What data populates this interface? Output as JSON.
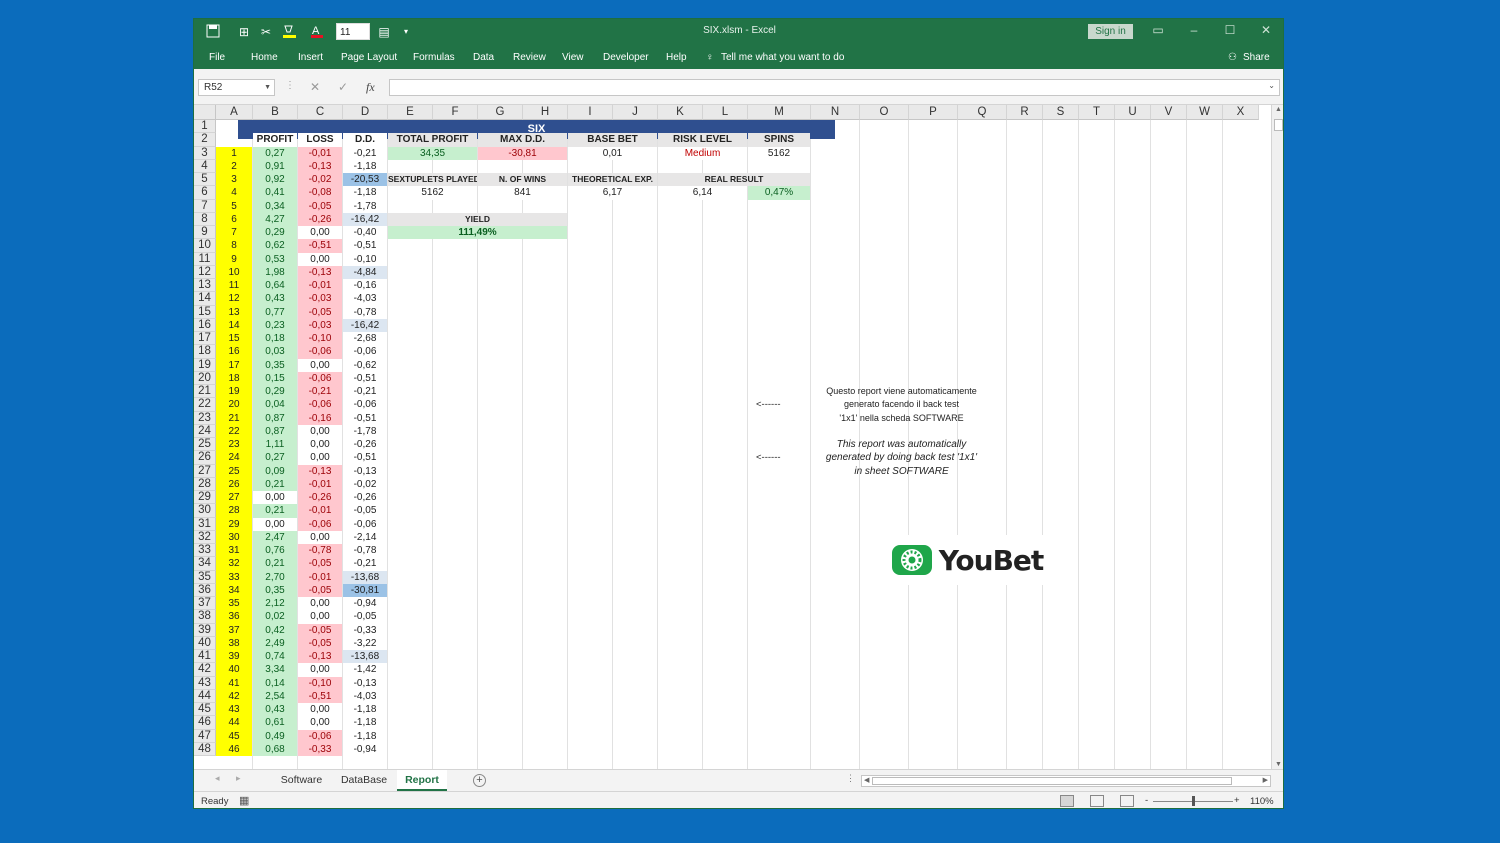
{
  "titlebar": {
    "filename": "SIX.xlsm",
    "app": "Excel",
    "sep": "-",
    "sign_in": "Sign in",
    "font_size": "11"
  },
  "menu": {
    "items": [
      "File",
      "Home",
      "Insert",
      "Page Layout",
      "Formulas",
      "Data",
      "Review",
      "View",
      "Developer",
      "Help"
    ],
    "tell_me": "Tell me what you want to do",
    "share": "Share"
  },
  "formula_bar": {
    "name_box": "R52",
    "fx": "fx",
    "value": ""
  },
  "columns": [
    "A",
    "B",
    "C",
    "D",
    "E",
    "F",
    "G",
    "H",
    "I",
    "J",
    "K",
    "L",
    "M",
    "N",
    "O",
    "P",
    "Q",
    "R",
    "S",
    "T",
    "U",
    "V",
    "W",
    "X"
  ],
  "rows": [
    1,
    2,
    3,
    4,
    5,
    6,
    7,
    8,
    9,
    10,
    11,
    12,
    13,
    14,
    15,
    16,
    17,
    18,
    19,
    20,
    21,
    22,
    23,
    24,
    25,
    26,
    27,
    28,
    29,
    30,
    31,
    32,
    33,
    34,
    35,
    36,
    37,
    38,
    39,
    40,
    41,
    42,
    43,
    44,
    45,
    46,
    47,
    48
  ],
  "sheet": {
    "title": "SIX",
    "headers": {
      "profit": "PROFIT",
      "loss": "LOSS",
      "dd": "D.D.",
      "total_profit": "TOTAL PROFIT",
      "max_dd": "MAX D.D.",
      "base_bet": "BASE BET",
      "risk_level": "RISK LEVEL",
      "spins": "SPINS"
    },
    "summary1": {
      "total_profit": "34,35",
      "max_dd": "-30,81",
      "base_bet": "0,01",
      "risk_level": "Medium",
      "spins": "5162"
    },
    "headers2": {
      "sextuplets": "SEXTUPLETS PLAYED",
      "wins": "N. OF WINS",
      "theoretical": "THEORETICAL EXP.",
      "real": "REAL RESULT"
    },
    "summary2": {
      "sextuplets": "5162",
      "wins": "841",
      "theoretical": "6,17",
      "real_value": "6,14",
      "real_pct": "0,47%"
    },
    "yield": {
      "label": "YIELD",
      "value": "111,49%"
    },
    "data_rows": [
      {
        "n": "1",
        "p": "0,27",
        "l": "-0,01",
        "d": "-0,21"
      },
      {
        "n": "2",
        "p": "0,91",
        "l": "-0,13",
        "d": "-1,18"
      },
      {
        "n": "3",
        "p": "0,92",
        "l": "-0,02",
        "d": "-20,53"
      },
      {
        "n": "4",
        "p": "0,41",
        "l": "-0,08",
        "d": "-1,18"
      },
      {
        "n": "5",
        "p": "0,34",
        "l": "-0,05",
        "d": "-1,78"
      },
      {
        "n": "6",
        "p": "4,27",
        "l": "-0,26",
        "d": "-16,42"
      },
      {
        "n": "7",
        "p": "0,29",
        "l": "0,00",
        "d": "-0,40"
      },
      {
        "n": "8",
        "p": "0,62",
        "l": "-0,51",
        "d": "-0,51"
      },
      {
        "n": "9",
        "p": "0,53",
        "l": "0,00",
        "d": "-0,10"
      },
      {
        "n": "10",
        "p": "1,98",
        "l": "-0,13",
        "d": "-4,84"
      },
      {
        "n": "11",
        "p": "0,64",
        "l": "-0,01",
        "d": "-0,16"
      },
      {
        "n": "12",
        "p": "0,43",
        "l": "-0,03",
        "d": "-4,03"
      },
      {
        "n": "13",
        "p": "0,77",
        "l": "-0,05",
        "d": "-0,78"
      },
      {
        "n": "14",
        "p": "0,23",
        "l": "-0,03",
        "d": "-16,42"
      },
      {
        "n": "15",
        "p": "0,18",
        "l": "-0,10",
        "d": "-2,68"
      },
      {
        "n": "16",
        "p": "0,03",
        "l": "-0,06",
        "d": "-0,06"
      },
      {
        "n": "17",
        "p": "0,35",
        "l": "0,00",
        "d": "-0,62"
      },
      {
        "n": "18",
        "p": "0,15",
        "l": "-0,06",
        "d": "-0,51"
      },
      {
        "n": "19",
        "p": "0,29",
        "l": "-0,21",
        "d": "-0,21"
      },
      {
        "n": "20",
        "p": "0,04",
        "l": "-0,06",
        "d": "-0,06"
      },
      {
        "n": "21",
        "p": "0,87",
        "l": "-0,16",
        "d": "-0,51"
      },
      {
        "n": "22",
        "p": "0,87",
        "l": "0,00",
        "d": "-1,78"
      },
      {
        "n": "23",
        "p": "1,11",
        "l": "0,00",
        "d": "-0,26"
      },
      {
        "n": "24",
        "p": "0,27",
        "l": "0,00",
        "d": "-0,51"
      },
      {
        "n": "25",
        "p": "0,09",
        "l": "-0,13",
        "d": "-0,13"
      },
      {
        "n": "26",
        "p": "0,21",
        "l": "-0,01",
        "d": "-0,02"
      },
      {
        "n": "27",
        "p": "0,00",
        "l": "-0,26",
        "d": "-0,26"
      },
      {
        "n": "28",
        "p": "0,21",
        "l": "-0,01",
        "d": "-0,05"
      },
      {
        "n": "29",
        "p": "0,00",
        "l": "-0,06",
        "d": "-0,06"
      },
      {
        "n": "30",
        "p": "2,47",
        "l": "0,00",
        "d": "-2,14"
      },
      {
        "n": "31",
        "p": "0,76",
        "l": "-0,78",
        "d": "-0,78"
      },
      {
        "n": "32",
        "p": "0,21",
        "l": "-0,05",
        "d": "-0,21"
      },
      {
        "n": "33",
        "p": "2,70",
        "l": "-0,01",
        "d": "-13,68"
      },
      {
        "n": "34",
        "p": "0,35",
        "l": "-0,05",
        "d": "-30,81"
      },
      {
        "n": "35",
        "p": "2,12",
        "l": "0,00",
        "d": "-0,94"
      },
      {
        "n": "36",
        "p": "0,02",
        "l": "0,00",
        "d": "-0,05"
      },
      {
        "n": "37",
        "p": "0,42",
        "l": "-0,05",
        "d": "-0,33"
      },
      {
        "n": "38",
        "p": "2,49",
        "l": "-0,05",
        "d": "-3,22"
      },
      {
        "n": "39",
        "p": "0,74",
        "l": "-0,13",
        "d": "-13,68"
      },
      {
        "n": "40",
        "p": "3,34",
        "l": "0,00",
        "d": "-1,42"
      },
      {
        "n": "41",
        "p": "0,14",
        "l": "-0,10",
        "d": "-0,13"
      },
      {
        "n": "42",
        "p": "2,54",
        "l": "-0,51",
        "d": "-4,03"
      },
      {
        "n": "43",
        "p": "0,43",
        "l": "0,00",
        "d": "-1,18"
      },
      {
        "n": "44",
        "p": "0,61",
        "l": "0,00",
        "d": "-1,18"
      },
      {
        "n": "45",
        "p": "0,49",
        "l": "-0,06",
        "d": "-1,18"
      },
      {
        "n": "46",
        "p": "0,68",
        "l": "-0,33",
        "d": "-0,94"
      }
    ],
    "notes": {
      "arrow": "<------",
      "it_line1": "Questo report viene automaticamente",
      "it_line2": "generato facendo il back test",
      "it_line3": "'1x1' nella scheda SOFTWARE",
      "en_line1": "This report was automatically",
      "en_line2": "generated by doing back test '1x1'",
      "en_line3": "in sheet SOFTWARE"
    },
    "logo_text": "YouBet"
  },
  "tabs": [
    "Software",
    "DataBase",
    "Report"
  ],
  "active_tab": "Report",
  "status": {
    "ready": "Ready",
    "zoom": "110%",
    "zoom_minus": "-",
    "zoom_plus": "+"
  },
  "colors": {
    "excel_green": "#217346",
    "title_blue": "#2f4f8f",
    "yellow": "#ffff00",
    "good_green": "#c6efce",
    "bad_red": "#ffc7ce",
    "dd_blue": "#dce6f1",
    "dd_blue_dark": "#9bc2e6",
    "background": "#0b6cbc"
  }
}
